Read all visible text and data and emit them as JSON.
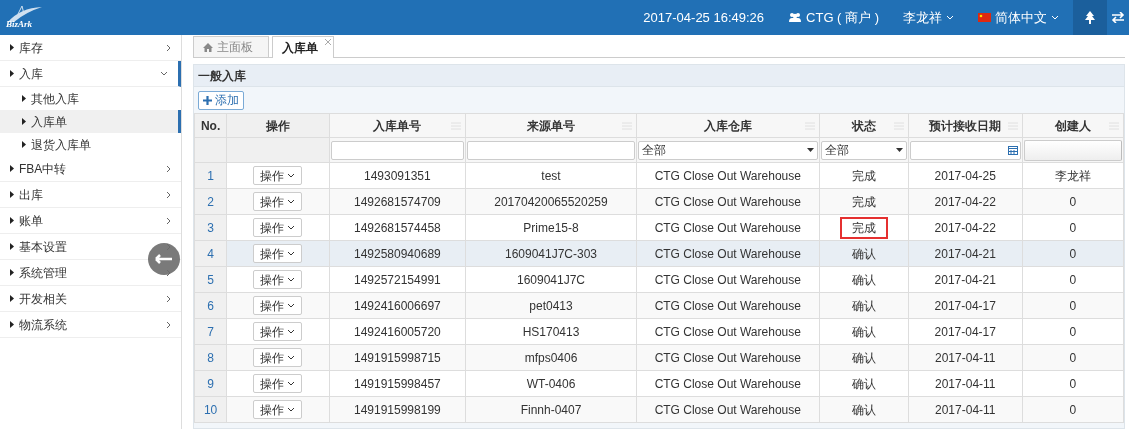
{
  "header": {
    "logo": "BizArk",
    "datetime": "2017-04-25 16:49:26",
    "account": "CTG ( 商户 )",
    "user": "李龙祥",
    "language": "简体中文"
  },
  "sidebar": {
    "items": [
      {
        "label": "库存",
        "expanded": false,
        "selected": false
      },
      {
        "label": "入库",
        "expanded": true,
        "selected": true,
        "children": [
          {
            "label": "其他入库",
            "selected": false
          },
          {
            "label": "入库单",
            "selected": true
          },
          {
            "label": "退货入库单",
            "selected": false
          }
        ]
      },
      {
        "label": "FBA中转",
        "expanded": false,
        "selected": false
      },
      {
        "label": "出库",
        "expanded": false,
        "selected": false
      },
      {
        "label": "账单",
        "expanded": false,
        "selected": false
      },
      {
        "label": "基本设置",
        "expanded": false,
        "selected": false
      },
      {
        "label": "系统管理",
        "expanded": false,
        "selected": false
      },
      {
        "label": "开发相关",
        "expanded": false,
        "selected": false
      },
      {
        "label": "物流系统",
        "expanded": false,
        "selected": false
      }
    ]
  },
  "tabs": [
    {
      "label": "主面板",
      "selected": false,
      "kind": "home"
    },
    {
      "label": "入库单",
      "selected": true,
      "kind": "closable"
    }
  ],
  "panel": {
    "title": "一般入库",
    "add_button": "添加"
  },
  "table": {
    "columns": [
      "No.",
      "操作",
      "入库单号",
      "来源单号",
      "入库仓库",
      "状态",
      "预计接收日期",
      "创建人"
    ],
    "filters": [
      {
        "kind": "none"
      },
      {
        "kind": "none"
      },
      {
        "kind": "text"
      },
      {
        "kind": "text"
      },
      {
        "kind": "select",
        "value": "全部"
      },
      {
        "kind": "select",
        "value": "全部"
      },
      {
        "kind": "date"
      },
      {
        "kind": "combo"
      }
    ],
    "rows": [
      {
        "no": "1",
        "action": "操作",
        "order": "1493091351",
        "source": "test",
        "warehouse": "CTG Close Out Warehouse",
        "status": "完成",
        "date": "2017-04-25",
        "creator": "李龙祥",
        "selected": false,
        "status_boxed": false
      },
      {
        "no": "2",
        "action": "操作",
        "order": "1492681574709",
        "source": "20170420065520259",
        "warehouse": "CTG Close Out Warehouse",
        "status": "完成",
        "date": "2017-04-22",
        "creator": "0",
        "selected": false,
        "status_boxed": false
      },
      {
        "no": "3",
        "action": "操作",
        "order": "1492681574458",
        "source": "Prime15-8",
        "warehouse": "CTG Close Out Warehouse",
        "status": "完成",
        "date": "2017-04-22",
        "creator": "0",
        "selected": false,
        "status_boxed": true
      },
      {
        "no": "4",
        "action": "操作",
        "order": "1492580940689",
        "source": "1609041J7C-303",
        "warehouse": "CTG Close Out Warehouse",
        "status": "确认",
        "date": "2017-04-21",
        "creator": "0",
        "selected": true,
        "status_boxed": false
      },
      {
        "no": "5",
        "action": "操作",
        "order": "1492572154991",
        "source": "1609041J7C",
        "warehouse": "CTG Close Out Warehouse",
        "status": "确认",
        "date": "2017-04-21",
        "creator": "0",
        "selected": false,
        "status_boxed": false
      },
      {
        "no": "6",
        "action": "操作",
        "order": "1492416006697",
        "source": "pet0413",
        "warehouse": "CTG Close Out Warehouse",
        "status": "确认",
        "date": "2017-04-17",
        "creator": "0",
        "selected": false,
        "status_boxed": false
      },
      {
        "no": "7",
        "action": "操作",
        "order": "1492416005720",
        "source": "HS170413",
        "warehouse": "CTG Close Out Warehouse",
        "status": "确认",
        "date": "2017-04-17",
        "creator": "0",
        "selected": false,
        "status_boxed": false
      },
      {
        "no": "8",
        "action": "操作",
        "order": "1491915998715",
        "source": "mfps0406",
        "warehouse": "CTG Close Out Warehouse",
        "status": "确认",
        "date": "2017-04-11",
        "creator": "0",
        "selected": false,
        "status_boxed": false
      },
      {
        "no": "9",
        "action": "操作",
        "order": "1491915998457",
        "source": "WT-0406",
        "warehouse": "CTG Close Out Warehouse",
        "status": "确认",
        "date": "2017-04-11",
        "creator": "0",
        "selected": false,
        "status_boxed": false
      },
      {
        "no": "10",
        "action": "操作",
        "order": "1491915998199",
        "source": "Finnh-0407",
        "warehouse": "CTG Close Out Warehouse",
        "status": "确认",
        "date": "2017-04-11",
        "creator": "0",
        "selected": false,
        "status_boxed": false
      }
    ]
  }
}
